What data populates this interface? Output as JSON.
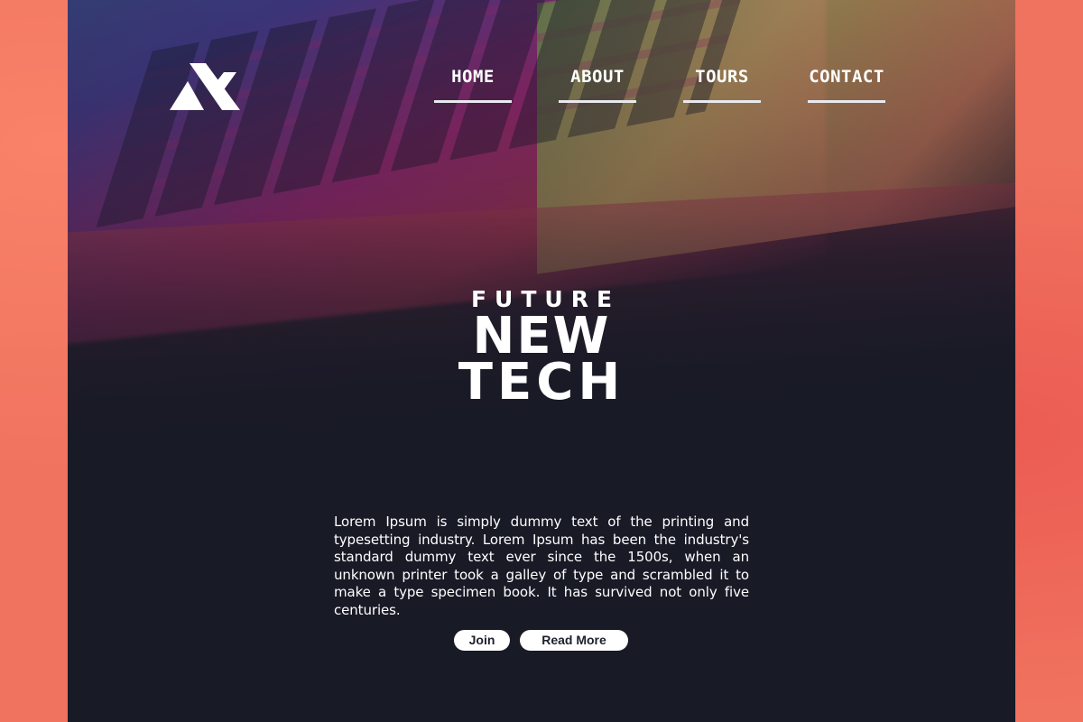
{
  "brand": {
    "logo_icon": "brand-logo-icon"
  },
  "nav": {
    "items": [
      {
        "label": "HOME"
      },
      {
        "label": "ABOUT"
      },
      {
        "label": "TOURS"
      },
      {
        "label": "CONTACT"
      }
    ]
  },
  "hero": {
    "kicker": "FUTURE",
    "title_line1": "NEW",
    "title_line2": "TECH",
    "description": "Lorem Ipsum is simply dummy text of the printing and typesetting industry. Lorem Ipsum has been the industry's standard dummy text ever since the 1500s, when an unknown printer took a galley of type and scrambled it to make a type specimen book. It has survived not only five centuries."
  },
  "buttons": {
    "join_label": "Join",
    "read_more_label": "Read More"
  },
  "colors": {
    "backdrop": "#f0735f",
    "site_background": "#181a26",
    "text": "#ffffff",
    "button_background": "#ffffff",
    "button_text": "#1d1f2b"
  }
}
